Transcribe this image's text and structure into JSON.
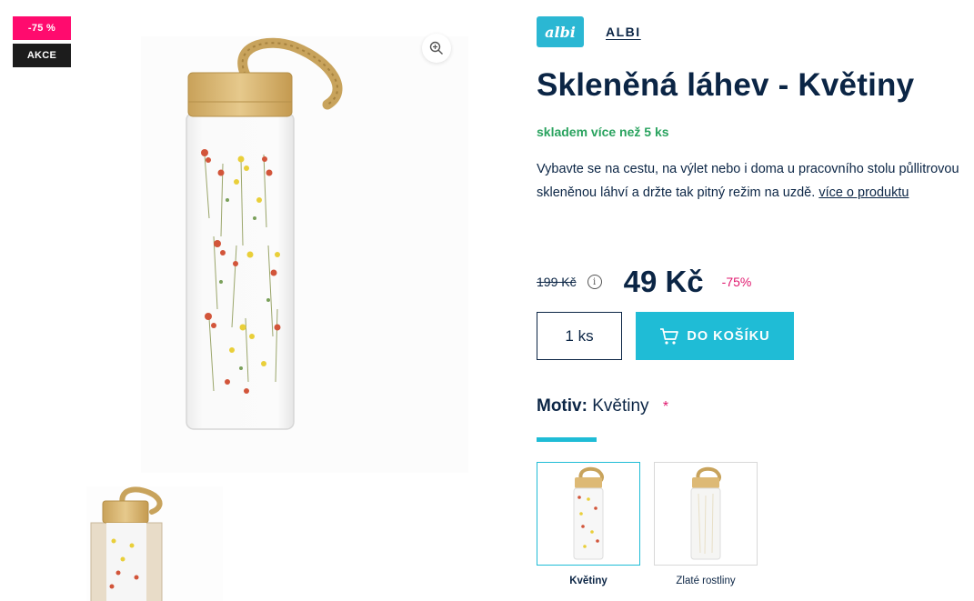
{
  "badges": {
    "discount": "-75 %",
    "sale": "AKCE"
  },
  "brand": {
    "logo_text": "albi",
    "name": "ALBI"
  },
  "product": {
    "title": "Skleněná láhev - Květiny",
    "stock": "skladem více než 5 ks",
    "description": "Vybavte se na cestu, na výlet nebo i doma u pracovního stolu půllitrovou skleněnou láhví a držte tak pitný režim na uzdě.",
    "more_link": "více o produktu"
  },
  "pricing": {
    "old_price": "199 Kč",
    "price": "49 Kč",
    "discount": "-75%"
  },
  "cart": {
    "quantity": "1 ks",
    "button_label": "DO KOŠÍKU"
  },
  "motiv": {
    "label": "Motiv:",
    "value": "Květiny",
    "required_mark": "*",
    "variants": [
      {
        "label": "Květiny",
        "selected": true
      },
      {
        "label": "Zlaté rostliny",
        "selected": false
      }
    ]
  },
  "colors": {
    "accent": "#1fbcd6",
    "brand_dark": "#0b2545",
    "pink": "#ff0b6e",
    "stock_green": "#2aa35f"
  },
  "icons": [
    "zoom-in-icon",
    "info-icon",
    "cart-icon"
  ]
}
